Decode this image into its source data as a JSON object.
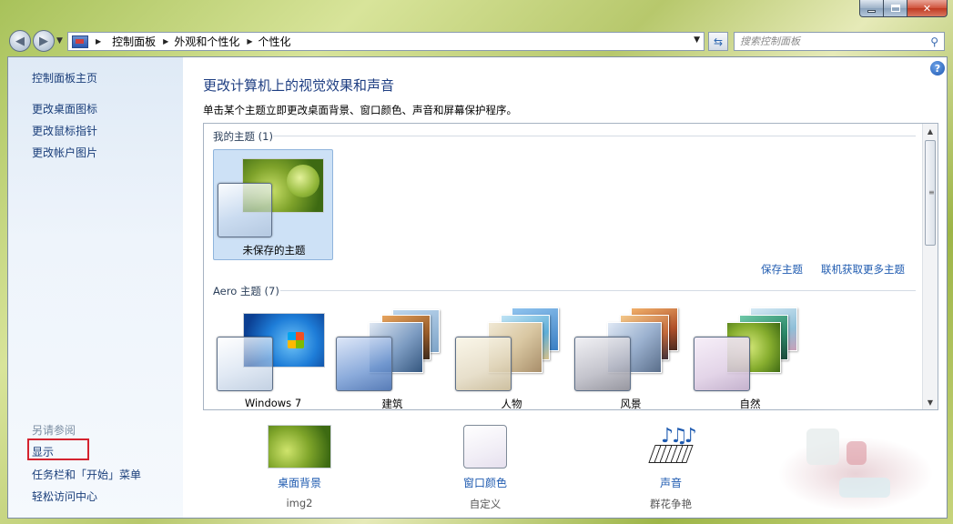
{
  "window": {
    "title": "",
    "buttons": {
      "minimize": "minimize",
      "maximize": "maximize",
      "close": "close"
    }
  },
  "navigation": {
    "back_icon": "back-arrow-icon",
    "forward_icon": "forward-arrow-icon",
    "breadcrumb": [
      "控制面板",
      "外观和个性化",
      "个性化"
    ],
    "search_placeholder": "搜索控制面板"
  },
  "sidebar": {
    "home": "控制面板主页",
    "links": [
      "更改桌面图标",
      "更改鼠标指针",
      "更改帐户图片"
    ],
    "see_also_heading": "另请参阅",
    "see_also": [
      "显示",
      "任务栏和「开始」菜单",
      "轻松访问中心"
    ]
  },
  "main": {
    "title": "更改计算机上的视觉效果和声音",
    "description": "单击某个主题立即更改桌面背景、窗口颜色、声音和屏幕保护程序。",
    "my_themes_label": "我的主题 (1)",
    "my_themes": [
      {
        "label": "未保存的主题",
        "selected": true
      }
    ],
    "save_theme": "保存主题",
    "get_more_themes": "联机获取更多主题",
    "aero_label": "Aero 主题 (7)",
    "aero_themes": [
      {
        "label": "Windows 7"
      },
      {
        "label": "建筑"
      },
      {
        "label": "人物"
      },
      {
        "label": "风景"
      },
      {
        "label": "自然"
      }
    ]
  },
  "bottom": {
    "items": [
      {
        "label": "桌面背景",
        "sub": "img2"
      },
      {
        "label": "窗口颜色",
        "sub": "自定义"
      },
      {
        "label": "声音",
        "sub": "群花争艳"
      }
    ]
  },
  "colors": {
    "link": "#1f5bb0",
    "title": "#1e3e82",
    "highlight_box": "#d4232f",
    "selected_tile": "#cde1f6"
  }
}
